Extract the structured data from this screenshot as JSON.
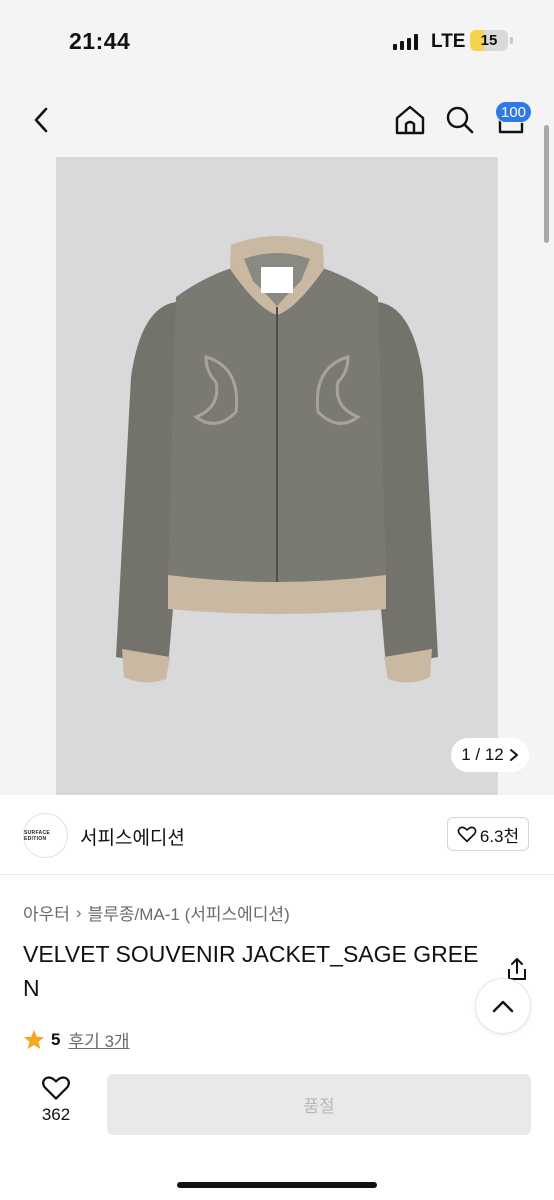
{
  "status_bar": {
    "time": "21:44",
    "network": "LTE",
    "battery": "15"
  },
  "nav": {
    "back_icon": "chevron-left-icon",
    "home_icon": "home-icon",
    "search_icon": "search-icon",
    "cart_icon": "cart-icon",
    "cart_badge": "100"
  },
  "gallery": {
    "current": "1 / 12",
    "arrow_icon": "chevron-right-icon",
    "image": "velvet-souvenir-jacket-photo"
  },
  "brand": {
    "logo_text": "SURFACE EDITION",
    "name": "서피스에디션",
    "likes": "6.3천"
  },
  "product": {
    "breadcrumb": [
      "아우터",
      "블루종/MA-1 (서피스에디션)"
    ],
    "title": "VELVET SOUVENIR JACKET_SAGE GREEN",
    "rating": "5",
    "reviews": "후기 3개"
  },
  "purchase_bar": {
    "wish_count": "362",
    "sold_out_label": "품절"
  },
  "colors": {
    "accent": "#2f78e8",
    "star": "#f5a623",
    "battery": "#f6d34a",
    "jacket": "#7b7a72",
    "rib": "#c9b9a2"
  }
}
